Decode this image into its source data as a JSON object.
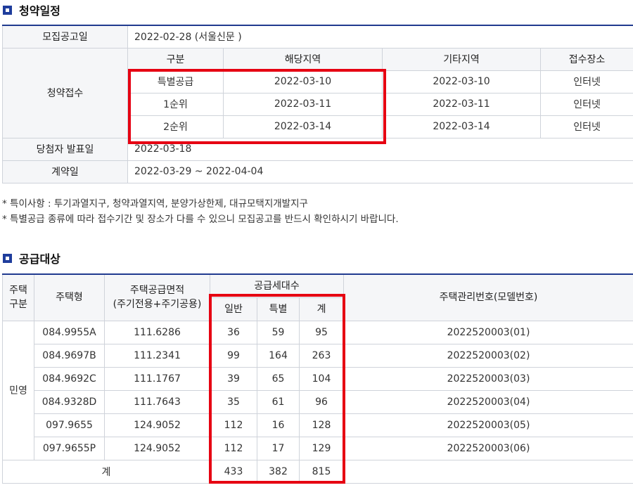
{
  "schedule_section": {
    "title": "청약일정",
    "announcement_label": "모집공고일",
    "announcement_value": "2022-02-28 (서울신문 )",
    "reception_label": "청약접수",
    "headers": [
      "구분",
      "해당지역",
      "기타지역",
      "접수장소"
    ],
    "rows": [
      [
        "특별공급",
        "2022-03-10",
        "2022-03-10",
        "인터넷"
      ],
      [
        "1순위",
        "2022-03-11",
        "2022-03-11",
        "인터넷"
      ],
      [
        "2순위",
        "2022-03-14",
        "2022-03-14",
        "인터넷"
      ]
    ],
    "winner_label": "당첨자 발표일",
    "winner_value": "2022-03-18",
    "contract_label": "계약일",
    "contract_value": "2022-03-29 ~ 2022-04-04"
  },
  "notes": [
    "* 특이사항 : 투기과열지구, 청약과열지역, 분양가상한제, 대규모택지개발지구",
    "* 특별공급 종류에 따라 접수기간 및 장소가 다를 수 있으니 모집공고를 반드시 확인하시기 바랍니다."
  ],
  "supply_section": {
    "title": "공급대상",
    "headers": {
      "housing_category_line1": "주택",
      "housing_category_line2": "구분",
      "housing_type": "주택형",
      "area_line1": "주택공급면적",
      "area_line2": "(주기전용+주기공용)",
      "units": "공급세대수",
      "general": "일반",
      "special": "특별",
      "total": "계",
      "management_no": "주택관리번호(모델번호)"
    },
    "category_value": "민영",
    "rows": [
      [
        "084.9955A",
        "111.6286",
        "36",
        "59",
        "95",
        "2022520003(01)"
      ],
      [
        "084.9697B",
        "111.2341",
        "99",
        "164",
        "263",
        "2022520003(02)"
      ],
      [
        "084.9692C",
        "111.1767",
        "39",
        "65",
        "104",
        "2022520003(03)"
      ],
      [
        "084.9328D",
        "111.7643",
        "35",
        "61",
        "96",
        "2022520003(04)"
      ],
      [
        "097.9655",
        "124.9052",
        "112",
        "16",
        "128",
        "2022520003(05)"
      ],
      [
        "097.9655P",
        "124.9052",
        "112",
        "17",
        "129",
        "2022520003(06)"
      ]
    ],
    "sum_label": "계",
    "sum_general": "433",
    "sum_special": "382",
    "sum_total": "815"
  },
  "colors": {
    "accent": "#1f3d9c",
    "header_bg": "#f5f6f8",
    "border": "#cfd3da",
    "highlight": "#e60012"
  }
}
